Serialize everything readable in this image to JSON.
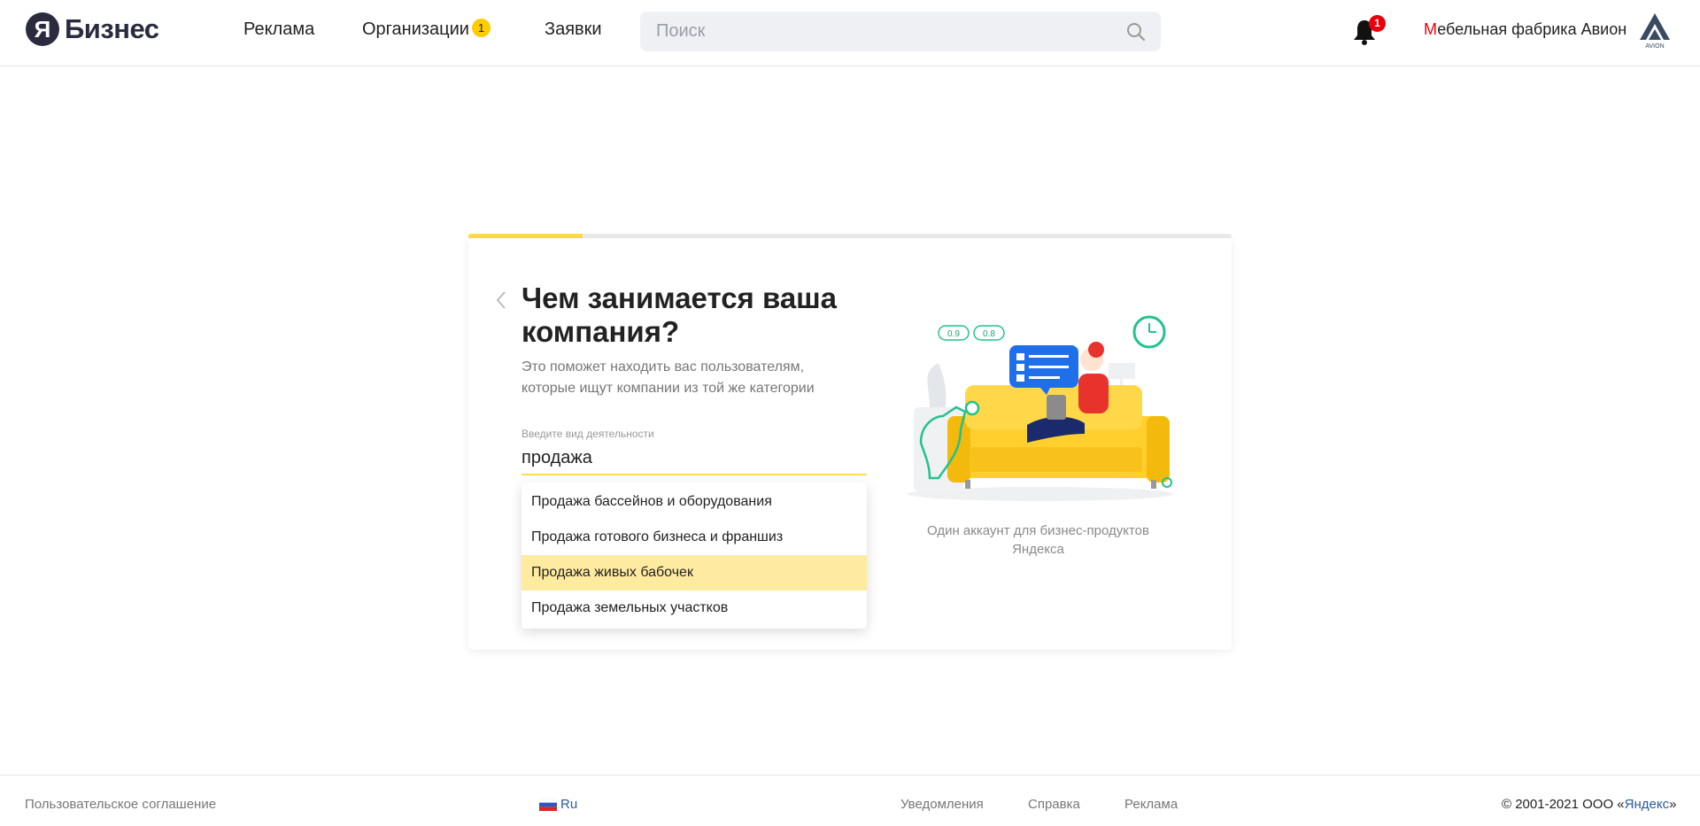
{
  "header": {
    "logo_letter": "Я",
    "logo_text": "Бизнес",
    "nav": [
      {
        "label": "Реклама"
      },
      {
        "label": "Организации",
        "badge": "1"
      },
      {
        "label": "Заявки"
      }
    ],
    "search": {
      "placeholder": "Поиск",
      "value": ""
    },
    "notifications_count": "1",
    "company_first_letter": "М",
    "company_rest": "ебельная фабрика Авион",
    "company_logo_text": "AVION"
  },
  "card": {
    "progress": 0.15,
    "title": "Чем занимается ваша компания?",
    "subtitle": "Это поможет находить вас пользователям, которые ищут компании из той же категории",
    "field_label": "Введите вид деятельности",
    "field_value": "продажа",
    "suggestions": [
      "Продажа бассейнов и оборудования",
      "Продажа готового бизнеса и франшиз",
      "Продажа живых бабочек",
      "Продажа земельных участков"
    ],
    "active_suggestion_index": 2,
    "illustration_badges": [
      "0.9",
      "0.8"
    ],
    "illustration_caption": "Один аккаунт для бизнес-продуктов Яндекса"
  },
  "footer": {
    "agreement": "Пользовательское соглашение",
    "lang": "Ru",
    "links": [
      "Уведомления",
      "Справка",
      "Реклама"
    ],
    "copyright_prefix": "© 2001-2021  ООО «",
    "copyright_link": "Яндекс",
    "copyright_suffix": "»"
  },
  "colors": {
    "accent_yellow": "#ffdb4d",
    "highlight": "#ffeba0",
    "badge_red": "#e8000a",
    "logo_dark": "#2b2b40",
    "link_blue": "#2c5aa0"
  }
}
